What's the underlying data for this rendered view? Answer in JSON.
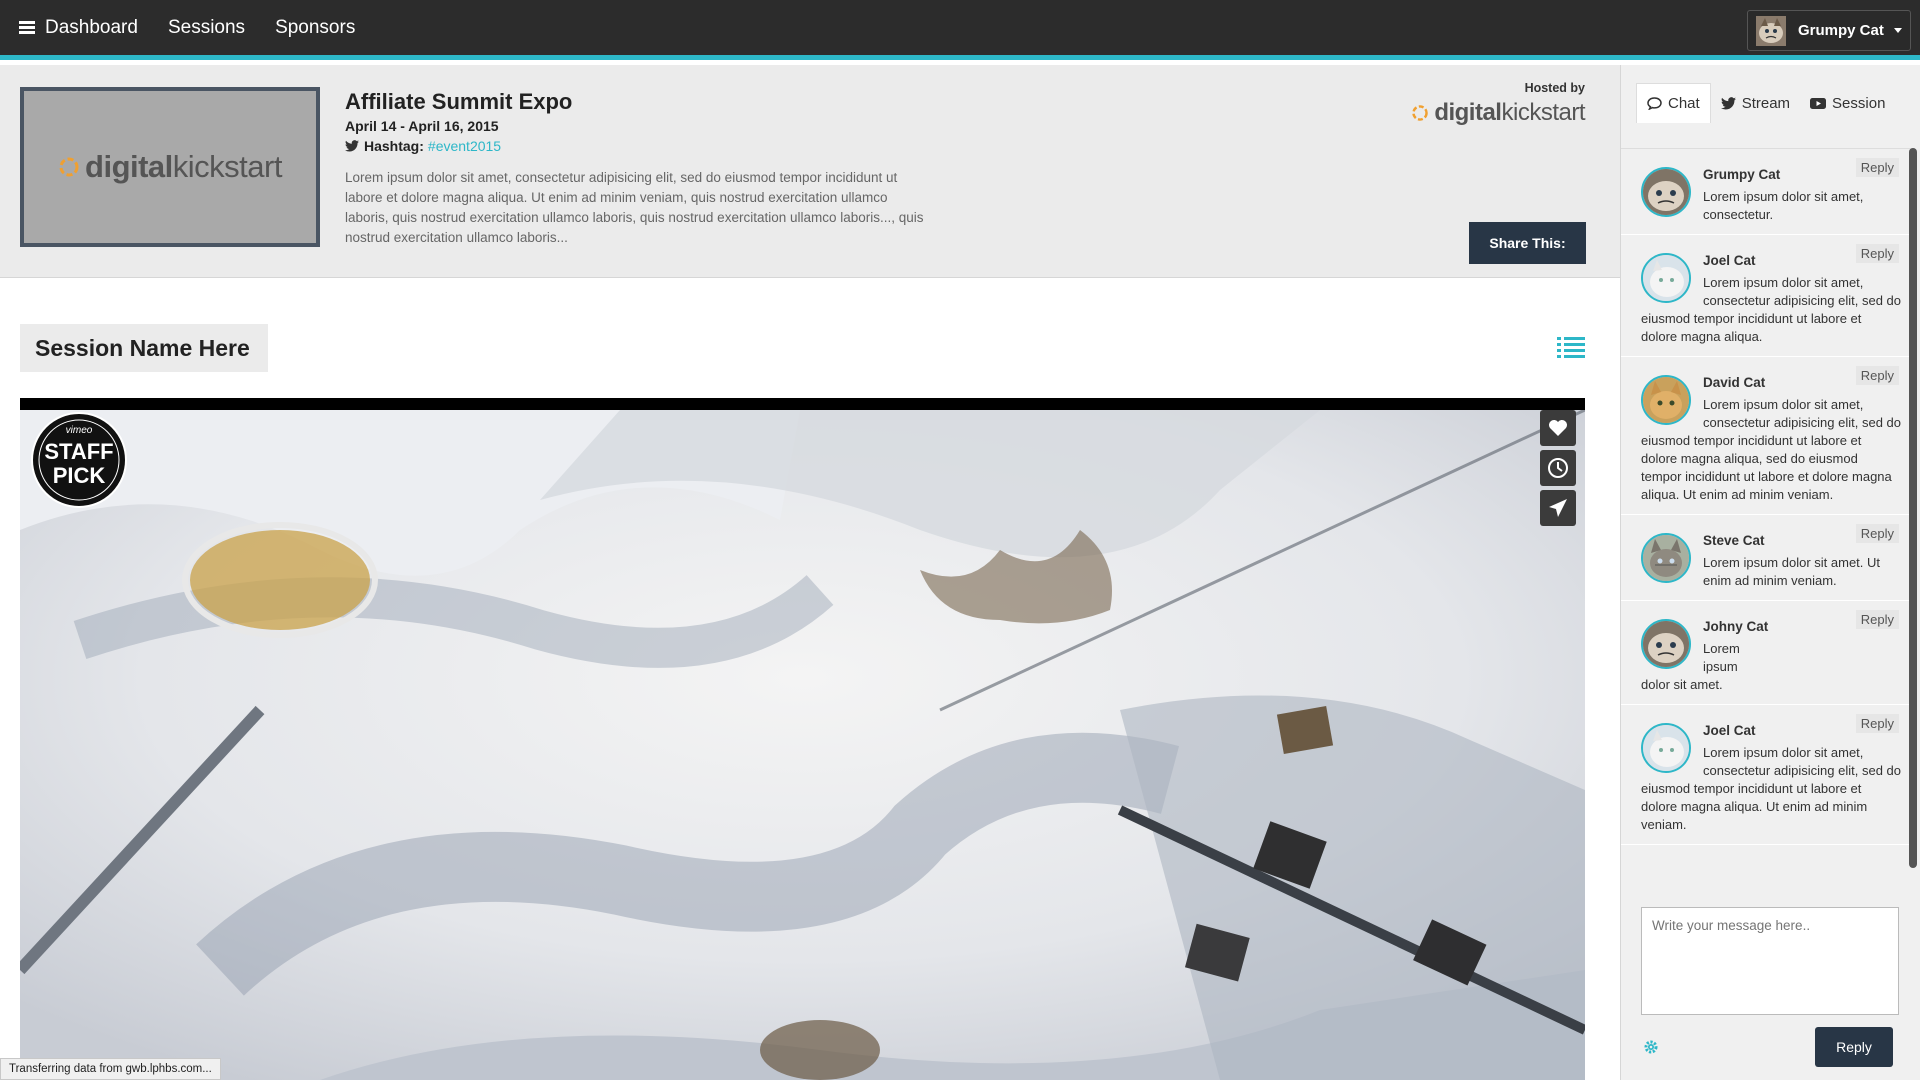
{
  "nav": {
    "items": [
      {
        "label": "Dashboard",
        "icon": "hamburger-icon"
      },
      {
        "label": "Sessions"
      },
      {
        "label": "Sponsors"
      }
    ],
    "user_name": "Grumpy Cat"
  },
  "event": {
    "title": "Affiliate Summit Expo",
    "dates": "April 14 - April 16, 2015",
    "hashtag_label": "Hashtag:",
    "hashtag": "#event2015",
    "description": "Lorem ipsum dolor sit amet, consectetur adipisicing elit, sed do eiusmod tempor incididunt ut labore et dolore magna aliqua. Ut enim ad minim veniam, quis nostrud exercitation ullamco laboris, quis nostrud exercitation ullamco laboris, quis nostrud exercitation ullamco laboris..., quis nostrud exercitation ullamco laboris...",
    "hosted_by": "Hosted by",
    "logo": {
      "bold": "digital",
      "light": "kickstart"
    },
    "share_label": "Share This:"
  },
  "session": {
    "name": "Session Name Here",
    "staff_pick_badge": {
      "top": "vimeo",
      "line1": "STAFF",
      "line2": "PICK"
    }
  },
  "status_bar": "Transferring data from gwb.lphbs.com...",
  "chat": {
    "tabs": [
      {
        "label": "Chat",
        "icon": "comment-icon"
      },
      {
        "label": "Stream",
        "icon": "twitter-icon"
      },
      {
        "label": "Session",
        "icon": "youtube-icon"
      }
    ],
    "reply_label": "Reply",
    "messages": [
      {
        "name": "Grumpy Cat",
        "text": "Lorem ipsum dolor sit amet, consectetur."
      },
      {
        "name": "Joel Cat",
        "text": "Lorem ipsum dolor sit amet, consectetur adipisicing elit, sed do eiusmod tempor incididunt ut labore et dolore magna aliqua."
      },
      {
        "name": "David Cat",
        "text": "Lorem ipsum dolor sit amet, consectetur adipisicing elit, sed do eiusmod tempor incididunt ut labore et dolore magna aliqua, sed do eiusmod tempor incididunt ut labore et dolore magna aliqua. Ut enim ad minim veniam."
      },
      {
        "name": "Steve Cat",
        "text": "Lorem ipsum dolor sit amet. Ut enim ad minim veniam."
      },
      {
        "name": "Johny Cat",
        "text": "Lorem ipsum dolor sit amet."
      },
      {
        "name": "Joel Cat",
        "text": "Lorem ipsum dolor sit amet, consectetur adipisicing elit, sed do eiusmod tempor incididunt ut labore et dolore magna aliqua. Ut enim ad minim veniam."
      }
    ],
    "input_placeholder": "Write your message here..",
    "send_label": "Reply"
  },
  "colors": {
    "accent": "#2db7c8",
    "dark_button": "#283646",
    "nav_bg": "#2c2c2c"
  }
}
